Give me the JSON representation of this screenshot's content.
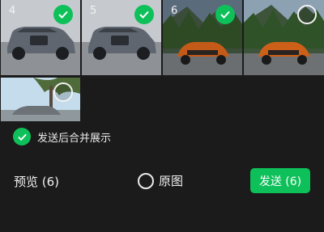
{
  "thumbnails": [
    {
      "index": "4",
      "selected": true,
      "subject": "suv"
    },
    {
      "index": "5",
      "selected": true,
      "subject": "suv"
    },
    {
      "index": "6",
      "selected": true,
      "subject": "sports-car"
    },
    {
      "index": "",
      "selected": false,
      "subject": "sports-car"
    },
    {
      "index": "",
      "selected": false,
      "subject": "beach-car"
    }
  ],
  "merge_option": {
    "label": "发送后合并展示",
    "checked": true
  },
  "bottom_bar": {
    "preview_label": "预览 (6)",
    "original_label": "原图",
    "original_checked": false,
    "send_label": "发送 (6)"
  },
  "colors": {
    "accent": "#0ec05a",
    "background": "#1b1b1b"
  }
}
